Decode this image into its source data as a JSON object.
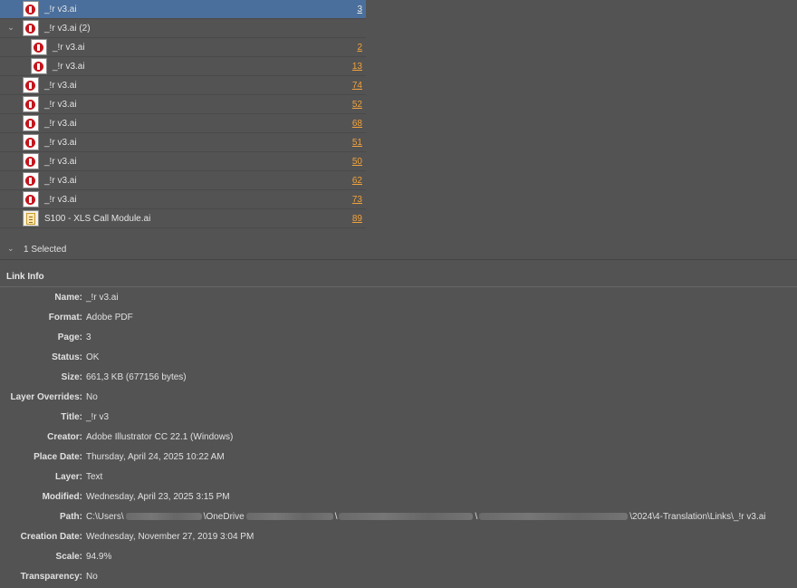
{
  "links": [
    {
      "name": "_!r v3.ai",
      "page": "3",
      "type": "pdf",
      "indent": 0,
      "selected": true
    },
    {
      "name": "_!r v3.ai (2)",
      "page": "",
      "type": "pdf",
      "indent": 0,
      "group": true
    },
    {
      "name": "_!r v3.ai",
      "page": "2",
      "type": "pdf",
      "indent": 1
    },
    {
      "name": "_!r v3.ai",
      "page": "13",
      "type": "pdf",
      "indent": 1
    },
    {
      "name": "_!r v3.ai",
      "page": "74",
      "type": "pdf",
      "indent": 0
    },
    {
      "name": "_!r v3.ai",
      "page": "52",
      "type": "pdf",
      "indent": 0
    },
    {
      "name": "_!r v3.ai",
      "page": "68",
      "type": "pdf",
      "indent": 0
    },
    {
      "name": "_!r v3.ai",
      "page": "51",
      "type": "pdf",
      "indent": 0
    },
    {
      "name": "_!r v3.ai",
      "page": "50",
      "type": "pdf",
      "indent": 0
    },
    {
      "name": "_!r v3.ai",
      "page": "62",
      "type": "pdf",
      "indent": 0
    },
    {
      "name": "_!r v3.ai",
      "page": "73",
      "type": "pdf",
      "indent": 0
    },
    {
      "name": "S100 - XLS Call Module.ai",
      "page": "89",
      "type": "ai",
      "indent": 0
    }
  ],
  "selection": {
    "label": "1 Selected"
  },
  "link_info": {
    "heading": "Link Info",
    "rows": [
      {
        "key": "Name:",
        "value": "_!r v3.ai"
      },
      {
        "key": "Format:",
        "value": "Adobe PDF"
      },
      {
        "key": "Page:",
        "value": "3"
      },
      {
        "key": "Status:",
        "value": "OK"
      },
      {
        "key": "Size:",
        "value": "661,3 KB (677156 bytes)"
      },
      {
        "key": "Layer Overrides:",
        "value": "No"
      },
      {
        "key": "Title:",
        "value": "_!r v3"
      },
      {
        "key": "Creator:",
        "value": "Adobe Illustrator CC 22.1 (Windows)"
      },
      {
        "key": "Place Date:",
        "value": "Thursday, April 24, 2025 10:22 AM"
      },
      {
        "key": "Layer:",
        "value": "Text"
      },
      {
        "key": "Modified:",
        "value": "Wednesday, April 23, 2025 3:15 PM"
      },
      {
        "key": "Path:",
        "value": "",
        "path": true
      },
      {
        "key": "Creation Date:",
        "value": "Wednesday, November 27, 2019 3:04 PM"
      },
      {
        "key": "Scale:",
        "value": "94.9%"
      },
      {
        "key": "Transparency:",
        "value": "No"
      }
    ],
    "path_parts": {
      "start": "C:\\Users\\",
      "mid": "\\OneDrive",
      "sep1": "\\",
      "sep2": "\\",
      "sep3": "\\",
      "end": "\\2024\\4-Translation\\Links\\_!r v3.ai"
    }
  },
  "colors": {
    "panel": "#535353",
    "selected_row": "#4b6f9c",
    "page_link": "#f2a23c"
  },
  "icons": {
    "expand": "chevron-down-icon",
    "pdf_thumb": "pdf-thumbnail-icon",
    "ai_thumb": "ai-thumbnail-icon"
  }
}
